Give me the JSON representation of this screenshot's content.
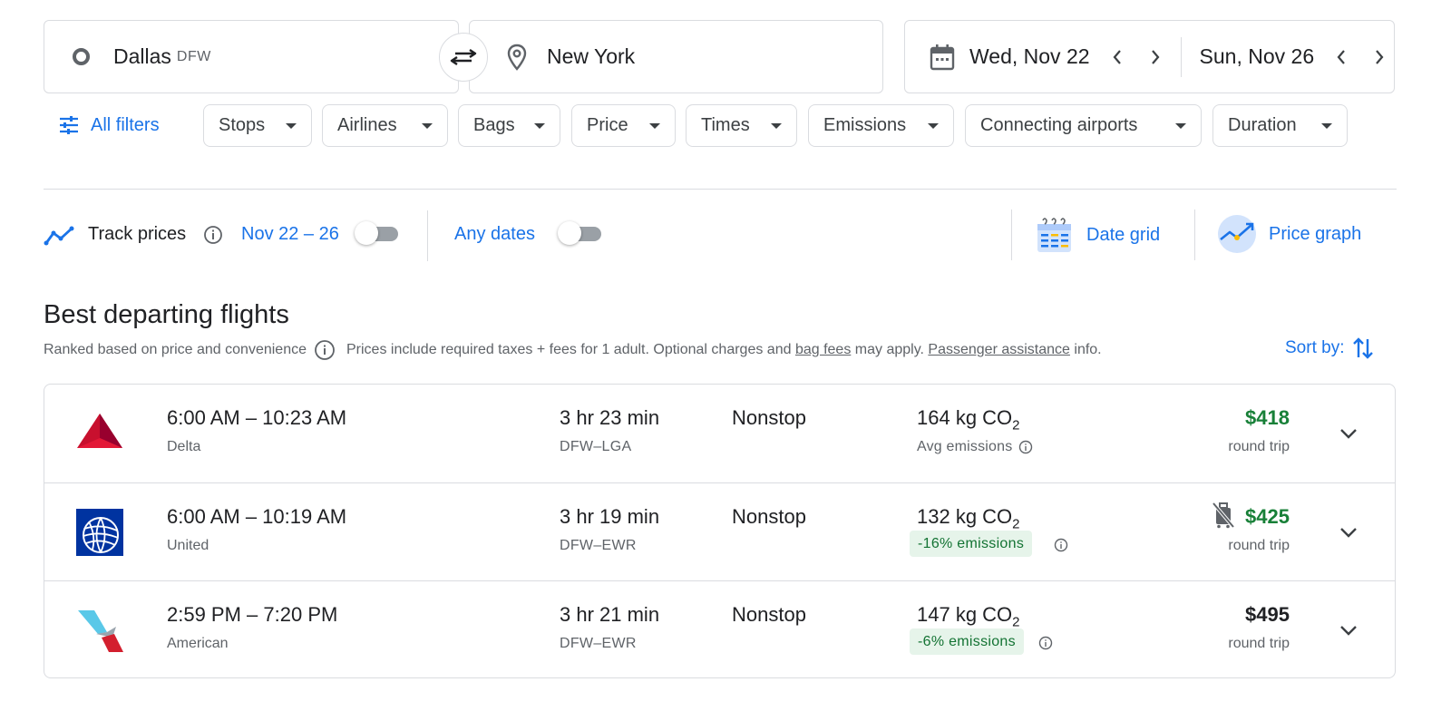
{
  "search": {
    "origin_city": "Dallas",
    "origin_code": "DFW",
    "destination": "New York",
    "depart_date": "Wed, Nov 22",
    "return_date": "Sun, Nov 26"
  },
  "filters": {
    "all_filters_label": "All filters",
    "chips": [
      "Stops",
      "Airlines",
      "Bags",
      "Price",
      "Times",
      "Emissions",
      "Connecting airports",
      "Duration"
    ]
  },
  "track": {
    "label": "Track prices",
    "date_range": "Nov 22 – 26",
    "any_dates_label": "Any dates",
    "date_grid_label": "Date grid",
    "price_graph_label": "Price graph"
  },
  "section": {
    "title": "Best departing flights",
    "ranked_text": "Ranked based on price and convenience",
    "prices_text_1": "Prices include required taxes + fees for 1 adult. Optional charges and ",
    "bag_fees_link": "bag fees",
    "prices_text_2": " may apply. ",
    "passenger_link": "Passenger assistance",
    "prices_text_3": " info.",
    "sort_label": "Sort by:"
  },
  "flights": [
    {
      "times": "6:00 AM – 10:23 AM",
      "airline": "Delta",
      "duration": "3 hr 23 min",
      "route": "DFW–LGA",
      "stops": "Nonstop",
      "co2_value": "164 kg CO",
      "co2_sub": "2",
      "emissions_note": "Avg emissions",
      "price": "$418",
      "price_color": "#188038",
      "price_type": "round trip"
    },
    {
      "times": "6:00 AM – 10:19 AM",
      "airline": "United",
      "duration": "3 hr 19 min",
      "route": "DFW–EWR",
      "stops": "Nonstop",
      "co2_value": "132 kg CO",
      "co2_sub": "2",
      "emissions_note": "-16% emissions",
      "price": "$425",
      "price_color": "#188038",
      "price_type": "round trip"
    },
    {
      "times": "2:59 PM – 7:20 PM",
      "airline": "American",
      "duration": "3 hr 21 min",
      "route": "DFW–EWR",
      "stops": "Nonstop",
      "co2_value": "147 kg CO",
      "co2_sub": "2",
      "emissions_note": "-6% emissions",
      "price": "$495",
      "price_color": "#202124",
      "price_type": "round trip"
    }
  ],
  "colors": {
    "accent": "#1a73e8",
    "price_green": "#188038",
    "badge_bg": "#e6f4ea"
  }
}
